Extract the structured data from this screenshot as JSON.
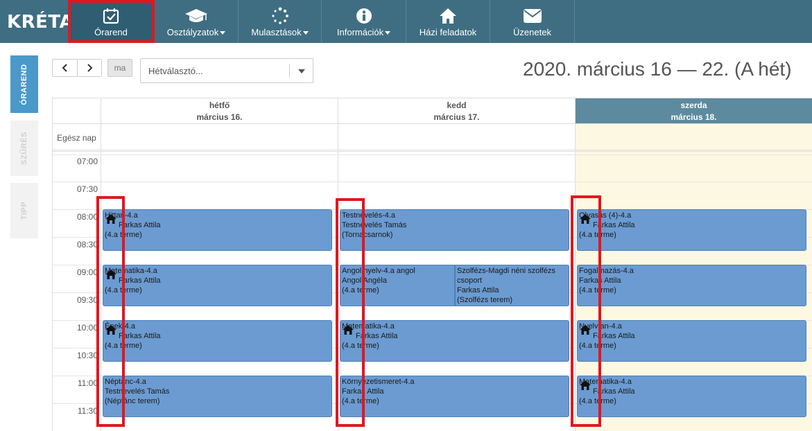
{
  "app": {
    "logo": "KRÉTA"
  },
  "nav": [
    {
      "label": "Órarend",
      "icon": "calendar-check-icon",
      "caret": false,
      "active": true
    },
    {
      "label": "Osztályzatok",
      "icon": "graduation-cap-icon",
      "caret": true,
      "active": false
    },
    {
      "label": "Mulasztások",
      "icon": "spinner-icon",
      "caret": true,
      "active": false
    },
    {
      "label": "Információk",
      "icon": "info-icon",
      "caret": true,
      "active": false
    },
    {
      "label": "Házi feladatok",
      "icon": "home-icon",
      "caret": false,
      "active": false
    },
    {
      "label": "Üzenetek",
      "icon": "envelope-icon",
      "caret": false,
      "active": false
    }
  ],
  "sidebar": {
    "tabs": [
      {
        "label": "ÓRAREND",
        "active": true
      },
      {
        "label": "SZŰRÉS",
        "active": false
      },
      {
        "label": "TIPP",
        "active": false
      }
    ]
  },
  "toolbar": {
    "prev": "‹",
    "next": "›",
    "today": "ma",
    "week_placeholder": "Hétválasztó..."
  },
  "title": "2020. március 16 — 22. (A hét)",
  "calendar": {
    "allday_label": "Egész nap",
    "days": [
      {
        "name": "hétfő",
        "date": "március 16.",
        "today": false
      },
      {
        "name": "kedd",
        "date": "március 17.",
        "today": false
      },
      {
        "name": "szerda",
        "date": "március 18.",
        "today": true
      }
    ],
    "times": [
      "07:00",
      "07:30",
      "08:00",
      "08:30",
      "09:00",
      "09:30",
      "10:00",
      "10:30",
      "11:00",
      "11:30"
    ],
    "events": {
      "d0": [
        {
          "lines": [
            "Hittan-4.a",
            "Farkas Attila",
            "(4.a terme)"
          ],
          "homework": true
        },
        {
          "lines": [
            "Matematika-4.a",
            "Farkas Attila",
            "(4.a terme)"
          ],
          "homework": true
        },
        {
          "lines": [
            "Ének-4.a",
            "Farkas Attila",
            "(4.a terme)"
          ],
          "homework": true
        },
        {
          "lines": [
            "Néptánc-4.a",
            "Testnevelés Tamás",
            "(Néptánc terem)"
          ],
          "homework": false
        }
      ],
      "d1": [
        {
          "lines": [
            "Testnevelés-4.a",
            "Testnevelés Tamás",
            "(Tornacsarnok)"
          ],
          "homework": false
        },
        {
          "lines": [
            "Angol nyelv-4.a angol",
            "Angol Angéla",
            "(4.a terme)"
          ],
          "homework": false
        },
        {
          "lines": [
            "Szolfézs-Magdi néni szolfézs",
            "csoport",
            "Farkas Attila",
            "(Szolfézs terem)"
          ],
          "homework": false
        },
        {
          "lines": [
            "Matematika-4.a",
            "Farkas Attila",
            "(4.a terme)"
          ],
          "homework": true
        },
        {
          "lines": [
            "Környezetismeret-4.a",
            "Farkas Attila",
            "(4.a terme)"
          ],
          "homework": false
        }
      ],
      "d2": [
        {
          "lines": [
            "Olvasás (4)-4.a",
            "Farkas Attila",
            "(4.a terme)"
          ],
          "homework": true
        },
        {
          "lines": [
            "Fogalmazás-4.a",
            "Farkas Attila",
            "(4.a terme)"
          ],
          "homework": false
        },
        {
          "lines": [
            "Nyelvtan-4.a",
            "Farkas Attila",
            "(4.a terme)"
          ],
          "homework": true
        },
        {
          "lines": [
            "Matematika-4.a",
            "Farkas Attila",
            "(4.a terme)"
          ],
          "homework": true
        }
      ]
    }
  },
  "colors": {
    "topbar": "#3f6e82",
    "event": "#6b9bd1",
    "today_header": "#5d8a9f",
    "today_column": "#fdf8e2",
    "highlight": "#e3161e"
  }
}
